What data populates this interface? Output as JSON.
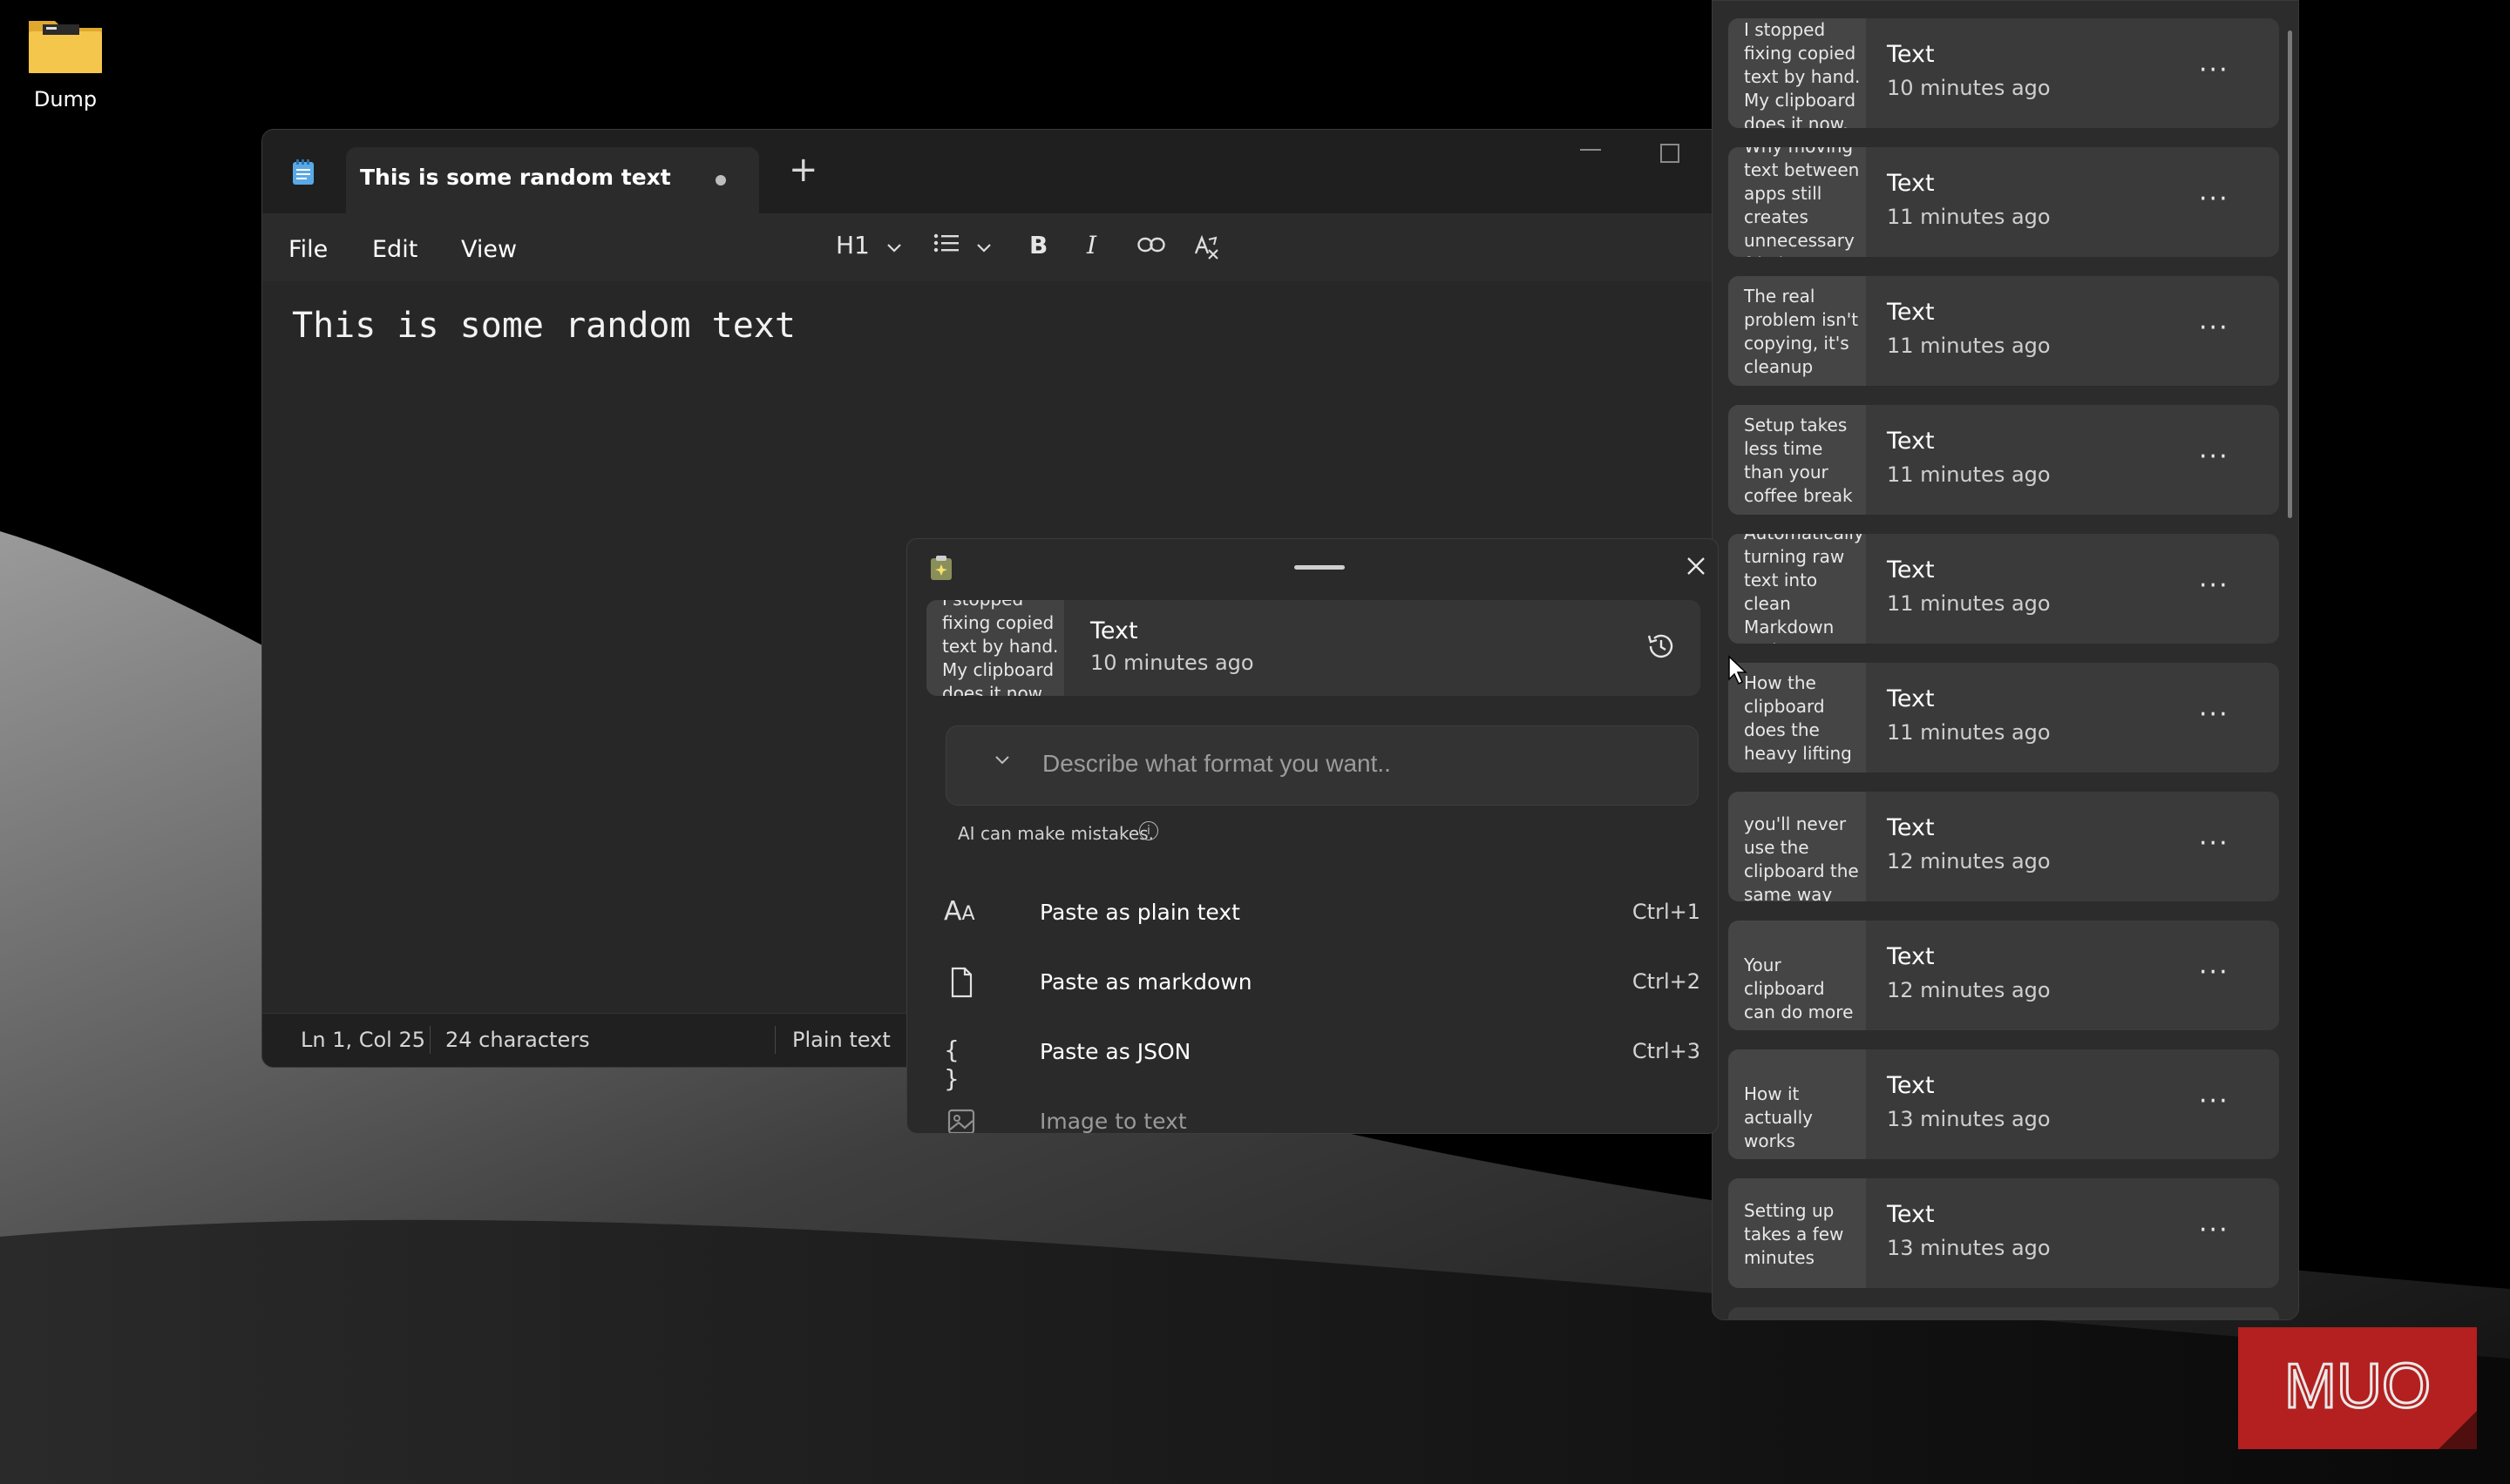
{
  "desktop": {
    "icon_label": "Dump"
  },
  "notepad": {
    "tab_title": "This is some random text",
    "menu": [
      "File",
      "Edit",
      "View"
    ],
    "heading_dropdown": "H1",
    "editor_text": "This is some random text",
    "status": {
      "position": "Ln 1, Col 25",
      "characters": "24 characters",
      "format": "Plain text"
    }
  },
  "paste": {
    "current_item": {
      "preview": "I stopped fixing copied text by hand. My clipboard does it now.",
      "type": "Text",
      "time": "10 minutes ago"
    },
    "input_placeholder": "Describe what format you want..",
    "ai_note": "AI can make mistakes.",
    "options": [
      {
        "label": "Paste as plain text",
        "shortcut": "Ctrl+1",
        "icon": "font-size-icon"
      },
      {
        "label": "Paste as markdown",
        "shortcut": "Ctrl+2",
        "icon": "document-icon"
      },
      {
        "label": "Paste as JSON",
        "shortcut": "Ctrl+3",
        "icon": "braces-icon"
      },
      {
        "label": "Image to text",
        "shortcut": "",
        "icon": "image-icon"
      }
    ]
  },
  "clipboard": {
    "items": [
      {
        "preview": "I stopped fixing copied text by hand. My clipboard does it now.",
        "type": "Text",
        "time": "10 minutes ago"
      },
      {
        "preview": "Why moving text between apps still creates unnecessary friction",
        "type": "Text",
        "time": "11 minutes ago"
      },
      {
        "preview": "The real problem isn't copying, it's cleanup",
        "type": "Text",
        "time": "11 minutes ago"
      },
      {
        "preview": "Setup takes less time than your coffee break",
        "type": "Text",
        "time": "11 minutes ago"
      },
      {
        "preview": "Automatically turning raw text into clean Markdown and structured JSON",
        "type": "Text",
        "time": "11 minutes ago"
      },
      {
        "preview": "How the clipboard does the heavy lifting",
        "type": "Text",
        "time": "11 minutes ago"
      },
      {
        "preview": "you'll never use the clipboard the same way",
        "type": "Text",
        "time": "12 minutes ago"
      },
      {
        "preview": "Your clipboard can do more",
        "type": "Text",
        "time": "12 minutes ago"
      },
      {
        "preview": "How it actually works",
        "type": "Text",
        "time": "13 minutes ago"
      },
      {
        "preview": "Setting up takes a few minutes",
        "type": "Text",
        "time": "13 minutes ago"
      }
    ]
  },
  "watermark": "MUO",
  "colors": {
    "desktop_bg": "#000000",
    "window_bg": "#272727",
    "panel_bg": "#2c2c2c",
    "watermark_red": "#b3201f"
  }
}
